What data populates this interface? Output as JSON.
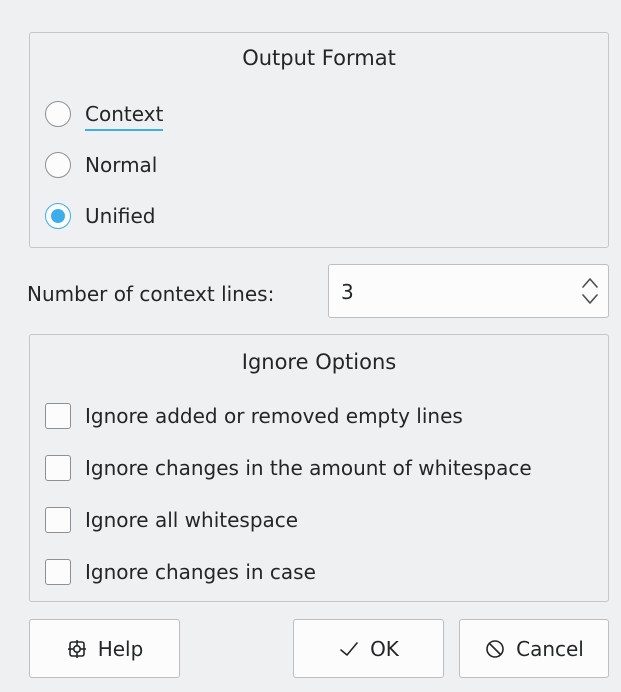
{
  "output_format": {
    "title": "Output Format",
    "options": [
      {
        "label": "Context",
        "checked": false,
        "focused": true
      },
      {
        "label": "Normal",
        "checked": false,
        "focused": false
      },
      {
        "label": "Unified",
        "checked": true,
        "focused": false
      }
    ]
  },
  "context_lines": {
    "label": "Number of context lines:",
    "value": "3"
  },
  "ignore_options": {
    "title": "Ignore Options",
    "options": [
      {
        "label": "Ignore added or removed empty lines",
        "checked": false
      },
      {
        "label": "Ignore changes in the amount of whitespace",
        "checked": false
      },
      {
        "label": "Ignore all whitespace",
        "checked": false
      },
      {
        "label": "Ignore changes in case",
        "checked": false
      }
    ]
  },
  "buttons": {
    "help": {
      "label": "Help",
      "icon": "help-lifebuoy-icon"
    },
    "ok": {
      "label": "OK",
      "icon": "checkmark-icon"
    },
    "cancel": {
      "label": "Cancel",
      "icon": "cancel-circle-icon"
    }
  },
  "colors": {
    "accent": "#3daee9",
    "window_bg": "#eff0f1",
    "field_bg": "#fcfcfc",
    "text": "#232627"
  }
}
